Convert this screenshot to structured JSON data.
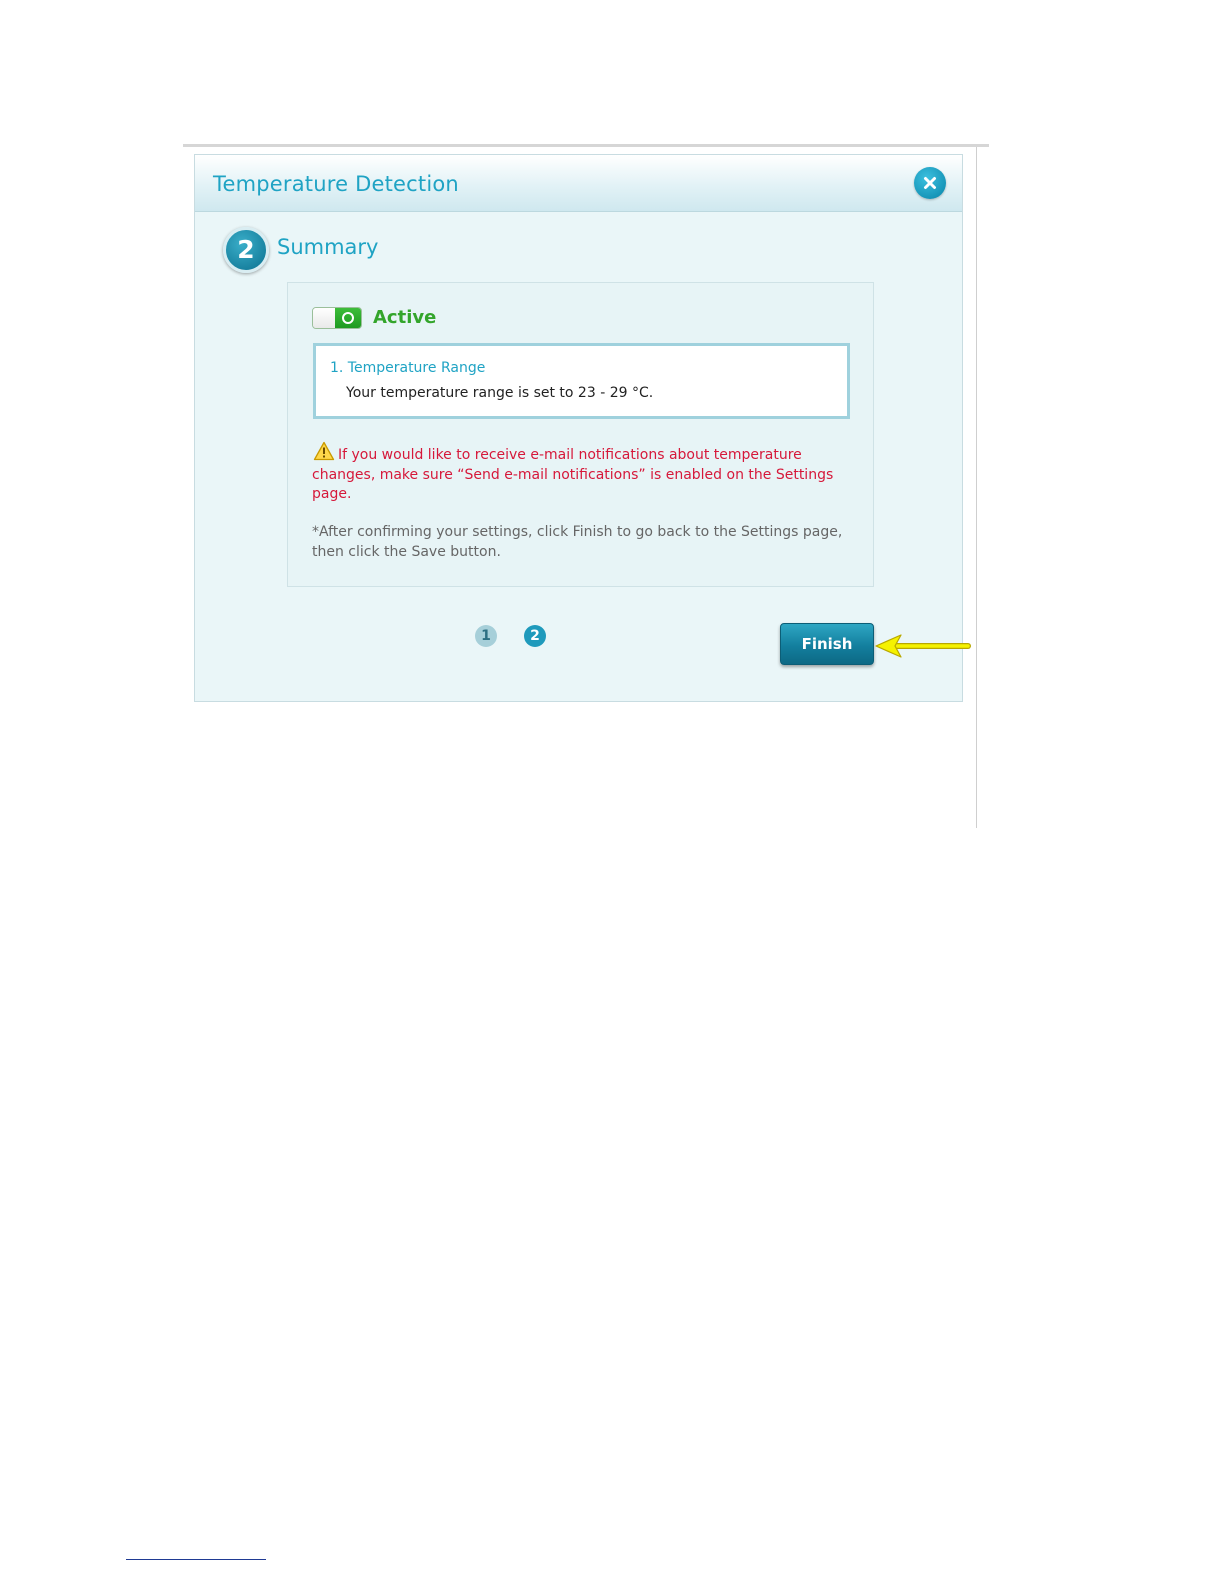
{
  "dialog": {
    "title": "Temperature Detection",
    "close_label": "close"
  },
  "step": {
    "number": "2",
    "title": "Summary"
  },
  "status": {
    "active_label": "Active",
    "enabled": true
  },
  "temperature_range": {
    "title": "1. Temperature Range",
    "text": "Your temperature range is set to 23 - 29 °C."
  },
  "warning": {
    "text": "If you would like to receive e-mail notifications about temperature changes, make sure “Send e-mail notifications” is enabled on the Settings page."
  },
  "note": {
    "text": "*After confirming your settings, click Finish to go back to the Settings page, then click the Save button."
  },
  "pagination": {
    "pages": [
      "1",
      "2"
    ],
    "current": "2"
  },
  "actions": {
    "finish_label": "Finish"
  },
  "colors": {
    "accent": "#1fa3c4",
    "active_green": "#33a52b",
    "warning_red": "#d6183a",
    "button": "#137f9e",
    "arrow": "#f5f200"
  }
}
